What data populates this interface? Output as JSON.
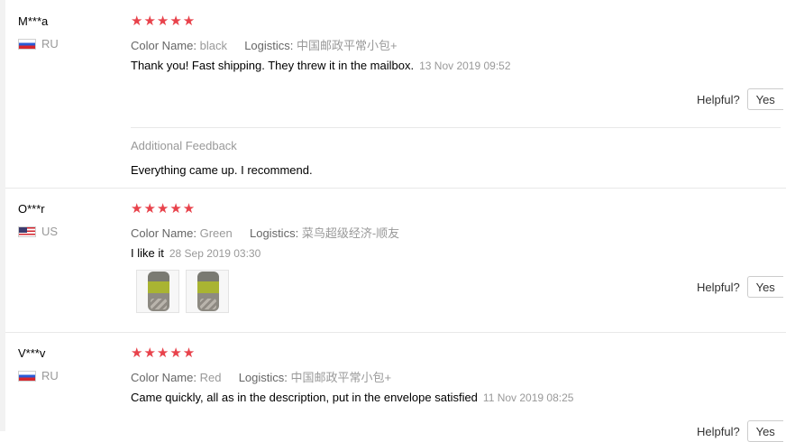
{
  "reviews": [
    {
      "user": "M***a",
      "country": "RU",
      "stars": "★★★★★",
      "color_key": "Color Name:",
      "color_value": "black",
      "logistics_key": "Logistics:",
      "logistics_value": "中国邮政平常小包+",
      "feedback": "Thank you! Fast shipping. They threw it in the mailbox.",
      "date": "13 Nov 2019 09:52",
      "helpful_label": "Helpful?",
      "yes_label": "Yes",
      "additional_label": "Additional Feedback",
      "additional_text": "Everything came up. I recommend."
    },
    {
      "user": "O***r",
      "country": "US",
      "stars": "★★★★★",
      "color_key": "Color Name:",
      "color_value": "Green",
      "logistics_key": "Logistics:",
      "logistics_value": "菜鸟超级经济-顺友",
      "feedback": "I like it",
      "date": "28 Sep 2019 03:30",
      "helpful_label": "Helpful?",
      "yes_label": "Yes"
    },
    {
      "user": "V***v",
      "country": "RU",
      "stars": "★★★★★",
      "color_key": "Color Name:",
      "color_value": "Red",
      "logistics_key": "Logistics:",
      "logistics_value": "中国邮政平常小包+",
      "feedback": "Came quickly, all as in the description, put in the envelope satisfied",
      "date": "11 Nov 2019 08:25",
      "helpful_label": "Helpful?",
      "yes_label": "Yes"
    }
  ],
  "colors": {
    "star": "#e8424b",
    "muted": "#999999",
    "divider": "#e8e8e8"
  }
}
